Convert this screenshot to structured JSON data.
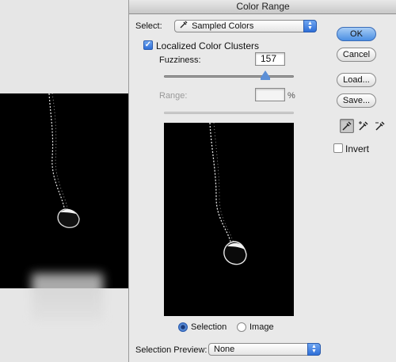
{
  "dialog": {
    "title": "Color Range",
    "select_label": "Select:",
    "select_value": "Sampled Colors",
    "localized_label": "Localized Color Clusters",
    "localized_checked": true,
    "fuzziness_label": "Fuzziness:",
    "fuzziness_value": "157",
    "fuzziness_percent_of_max": 0.78,
    "range_label": "Range:",
    "range_value": "",
    "range_unit": "%",
    "preview_options": [
      {
        "label": "Selection",
        "selected": true
      },
      {
        "label": "Image",
        "selected": false
      }
    ],
    "selection_preview_label": "Selection Preview:",
    "selection_preview_value": "None"
  },
  "buttons": {
    "ok": "OK",
    "cancel": "Cancel",
    "load": "Load...",
    "save": "Save..."
  },
  "tools": [
    {
      "name": "eyedropper-icon",
      "active": true
    },
    {
      "name": "eyedropper-plus-icon",
      "active": false
    },
    {
      "name": "eyedropper-minus-icon",
      "active": false
    }
  ],
  "invert": {
    "label": "Invert",
    "checked": false
  },
  "colors": {
    "accent": "#3a70c8",
    "dialog_bg": "#e9e9e9",
    "preview_bg": "#000000"
  }
}
